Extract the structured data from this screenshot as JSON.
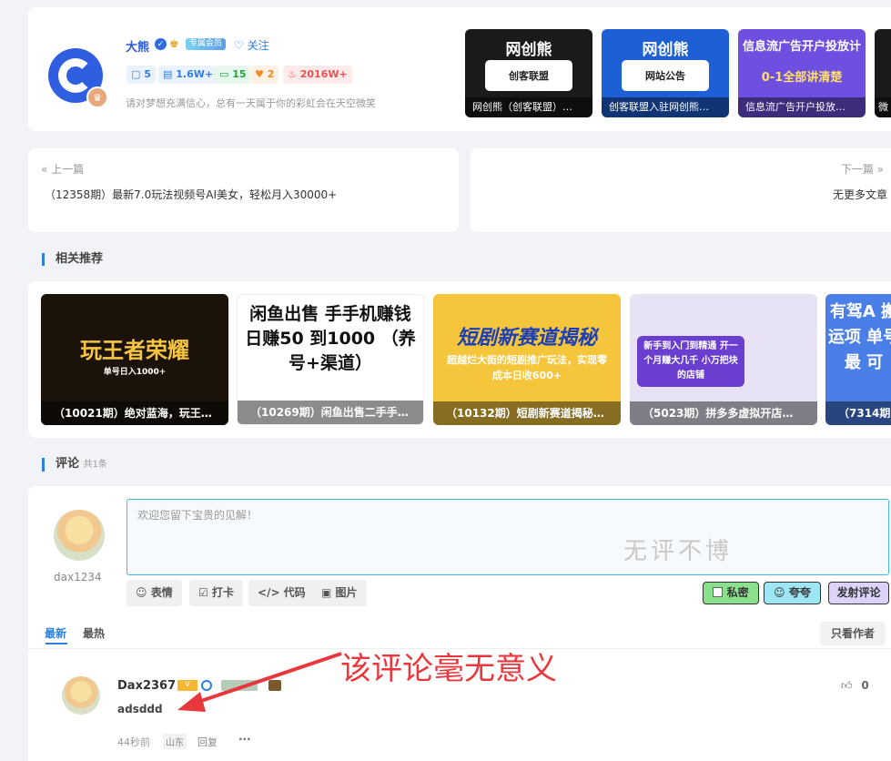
{
  "author": {
    "name": "大熊",
    "follow_label": "♡ 关注",
    "stats": [
      {
        "icon": "comment-icon",
        "value": "5",
        "color": "#2d7fe0",
        "bg": "#eaf2fd"
      },
      {
        "icon": "doc-icon",
        "value": "1.6W+",
        "color": "#2d7fe0",
        "bg": "#eaf2fd"
      },
      {
        "icon": "chat-icon",
        "value": "15",
        "color": "#22a348",
        "bg": "#e8f7ec"
      },
      {
        "icon": "heart-icon",
        "value": "2",
        "color": "#f08a24",
        "bg": "#fdf1e4"
      },
      {
        "icon": "fire-icon",
        "value": "2016W+",
        "color": "#f0504f",
        "bg": "#fdeaea"
      }
    ],
    "motto": "请对梦想充满信心，总有一天属于你的彩虹会在天空微笑",
    "rank_badge": "专属会员",
    "posts": [
      {
        "logo": "网创熊",
        "inner": "创客联盟",
        "caption": "网创熊（创客联盟）…",
        "bg": "#1a1a1a"
      },
      {
        "logo": "网创熊",
        "inner": "网站公告",
        "caption": "创客联盟入驻网创熊…",
        "bg": "#1f5fd6"
      },
      {
        "logo": "信息流广告开户投放计",
        "inner": "0-1全部讲清楚",
        "caption": "信息流广告开户投放…",
        "bg": "#6f4fe0"
      },
      {
        "logo": "微",
        "inner": "",
        "caption": "微",
        "bg": "#1a1a1a"
      }
    ]
  },
  "prev": {
    "label": "« 上一篇",
    "title": "（12358期）最新7.0玩法视频号AI美女，轻松月入30000+"
  },
  "next": {
    "label": "下一篇 »",
    "title": "无更多文章"
  },
  "related": {
    "heading": "相关推荐",
    "items": [
      {
        "big": "玩王者荣耀",
        "sub": "单号日入1000+",
        "caption": "（10021期）绝对蓝海，玩王…",
        "bg": "#1b130a",
        "fg": "#f5c542"
      },
      {
        "big": "闲鱼出售 手手机赚钱日赚50 到1000 （养号+渠道）",
        "sub": "",
        "caption": "（10269期）闲鱼出售二手手…",
        "bg": "#ffffff",
        "fg": "#111111"
      },
      {
        "big": "短剧新赛道揭秘",
        "sub": "超越烂大街的短剧推广玩法，实现零成本日收600+",
        "caption": "（10132期）短剧新赛道揭秘…",
        "bg": "#f5c63c",
        "fg": "#1c3fb5"
      },
      {
        "big": "新手到入门到精通 开一个月赚大几千 小万把块的店铺",
        "sub": "",
        "caption": "（5023期）拼多多虚拟开店…",
        "bg": "#e7e3f5",
        "fg": "#6a2fc8"
      },
      {
        "big": "有驾A 搬运项 单号最 可",
        "sub": "",
        "caption": "（7314期",
        "bg": "#4a7fe8",
        "fg": "#ffffff"
      }
    ]
  },
  "comments": {
    "heading": "评论",
    "count": "共1条",
    "current_user": "dax1234",
    "placeholder": "欢迎您留下宝贵的见解！",
    "watermark": "无评不博",
    "tools": [
      "☺ 表情",
      "☑ 打卡",
      "</> 代码",
      "▣ 图片"
    ],
    "private_label": "私密",
    "praise_label": "夸夸",
    "submit_label": "发射评论",
    "tabs": [
      "最新",
      "最热"
    ],
    "only_author": "只看作者",
    "items": [
      {
        "user": "Dax2367",
        "content": "adsddd",
        "time": "44秒前",
        "location": "山东",
        "reply": "回复",
        "more": "···",
        "likes": "0"
      }
    ]
  },
  "annotation": "该评论毫无意义"
}
